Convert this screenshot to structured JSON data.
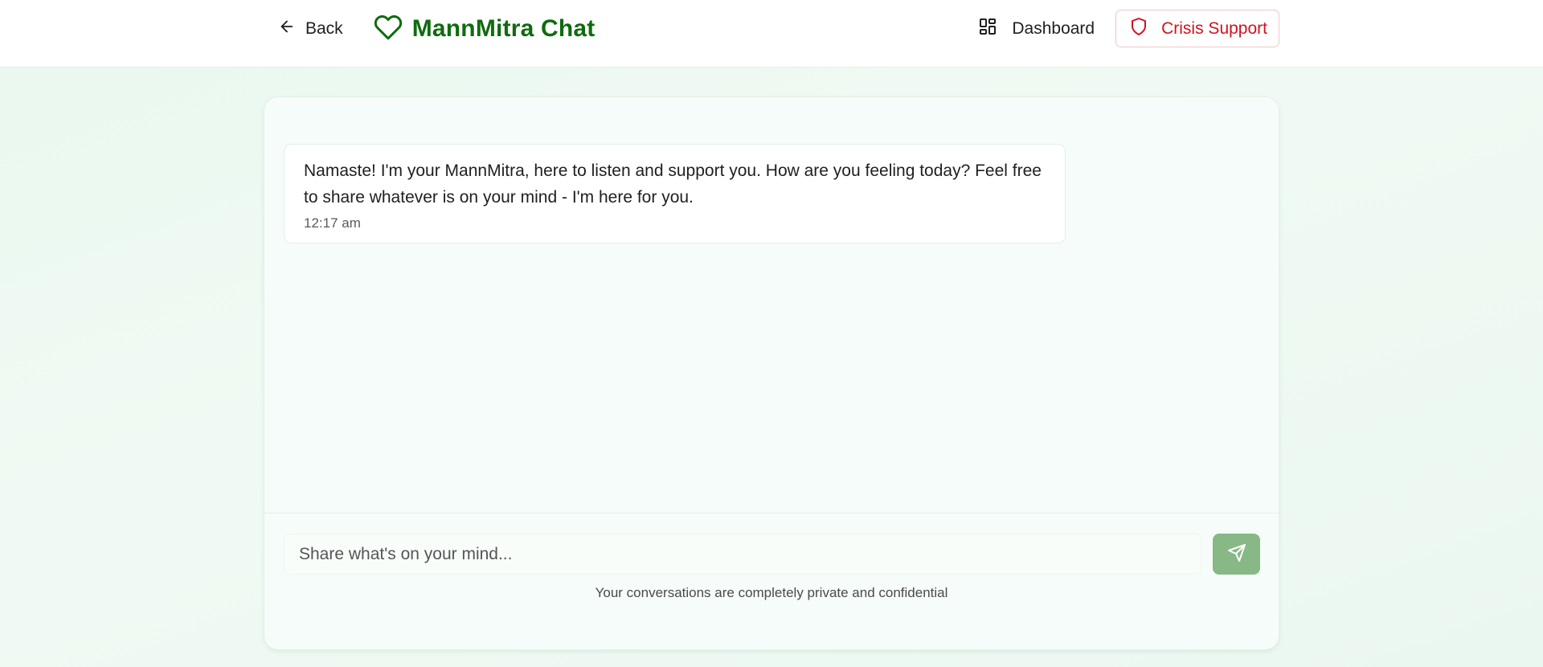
{
  "header": {
    "back_label": "Back",
    "title": "MannMitra Chat",
    "dashboard_label": "Dashboard",
    "crisis_label": "Crisis Support"
  },
  "chat": {
    "messages": [
      {
        "text": "Namaste! I'm your MannMitra, here to listen and support you. How are you feeling today? Feel free to share whatever is on your mind - I'm here for you.",
        "time": "12:17 am"
      }
    ],
    "input_placeholder": "Share what's on your mind...",
    "input_value": "",
    "privacy_note": "Your conversations are completely private and confidential"
  },
  "icons": {
    "back": "arrow-left-icon",
    "brand": "heart-icon",
    "dashboard": "dashboard-grid-icon",
    "crisis": "shield-icon",
    "send": "send-icon"
  },
  "colors": {
    "brand_green": "#0f6b0f",
    "crisis_red": "#d0121f",
    "send_button": "#87b886",
    "background": "#eaf8f0"
  }
}
